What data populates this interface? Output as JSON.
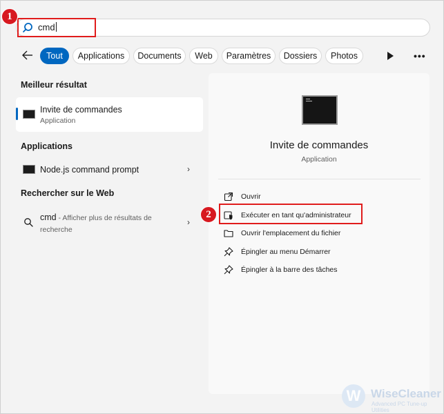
{
  "search": {
    "query": "cmd"
  },
  "annotations": {
    "step1": "1",
    "step2": "2"
  },
  "filters": {
    "tabs": [
      {
        "label": "Tout",
        "active": true
      },
      {
        "label": "Applications"
      },
      {
        "label": "Documents"
      },
      {
        "label": "Web"
      },
      {
        "label": "Paramètres"
      },
      {
        "label": "Dossiers"
      },
      {
        "label": "Photos"
      }
    ]
  },
  "left": {
    "best_heading": "Meilleur résultat",
    "best": {
      "title": "Invite de commandes",
      "subtitle": "Application"
    },
    "apps_heading": "Applications",
    "apps": [
      {
        "title": "Node.js command prompt"
      }
    ],
    "web_heading": "Rechercher sur le Web",
    "web": {
      "query": "cmd",
      "separator": " - ",
      "description": "Afficher plus de résultats de recherche"
    }
  },
  "preview": {
    "title": "Invite de commandes",
    "subtitle": "Application",
    "actions": [
      {
        "label": "Ouvrir",
        "icon": "open-external-icon"
      },
      {
        "label": "Exécuter en tant qu'administrateur",
        "icon": "shield-admin-icon"
      },
      {
        "label": "Ouvrir l'emplacement du fichier",
        "icon": "folder-icon"
      },
      {
        "label": "Épingler au menu Démarrer",
        "icon": "pin-icon"
      },
      {
        "label": "Épingler à la barre des tâches",
        "icon": "pin-icon"
      }
    ]
  },
  "watermark": {
    "name": "WiseCleaner",
    "tagline": "Advanced PC Tune-up Utilities",
    "logo_letter": "W"
  },
  "colors": {
    "accent": "#0067c0",
    "highlight": "#e01b1b",
    "badge": "#d71920"
  }
}
